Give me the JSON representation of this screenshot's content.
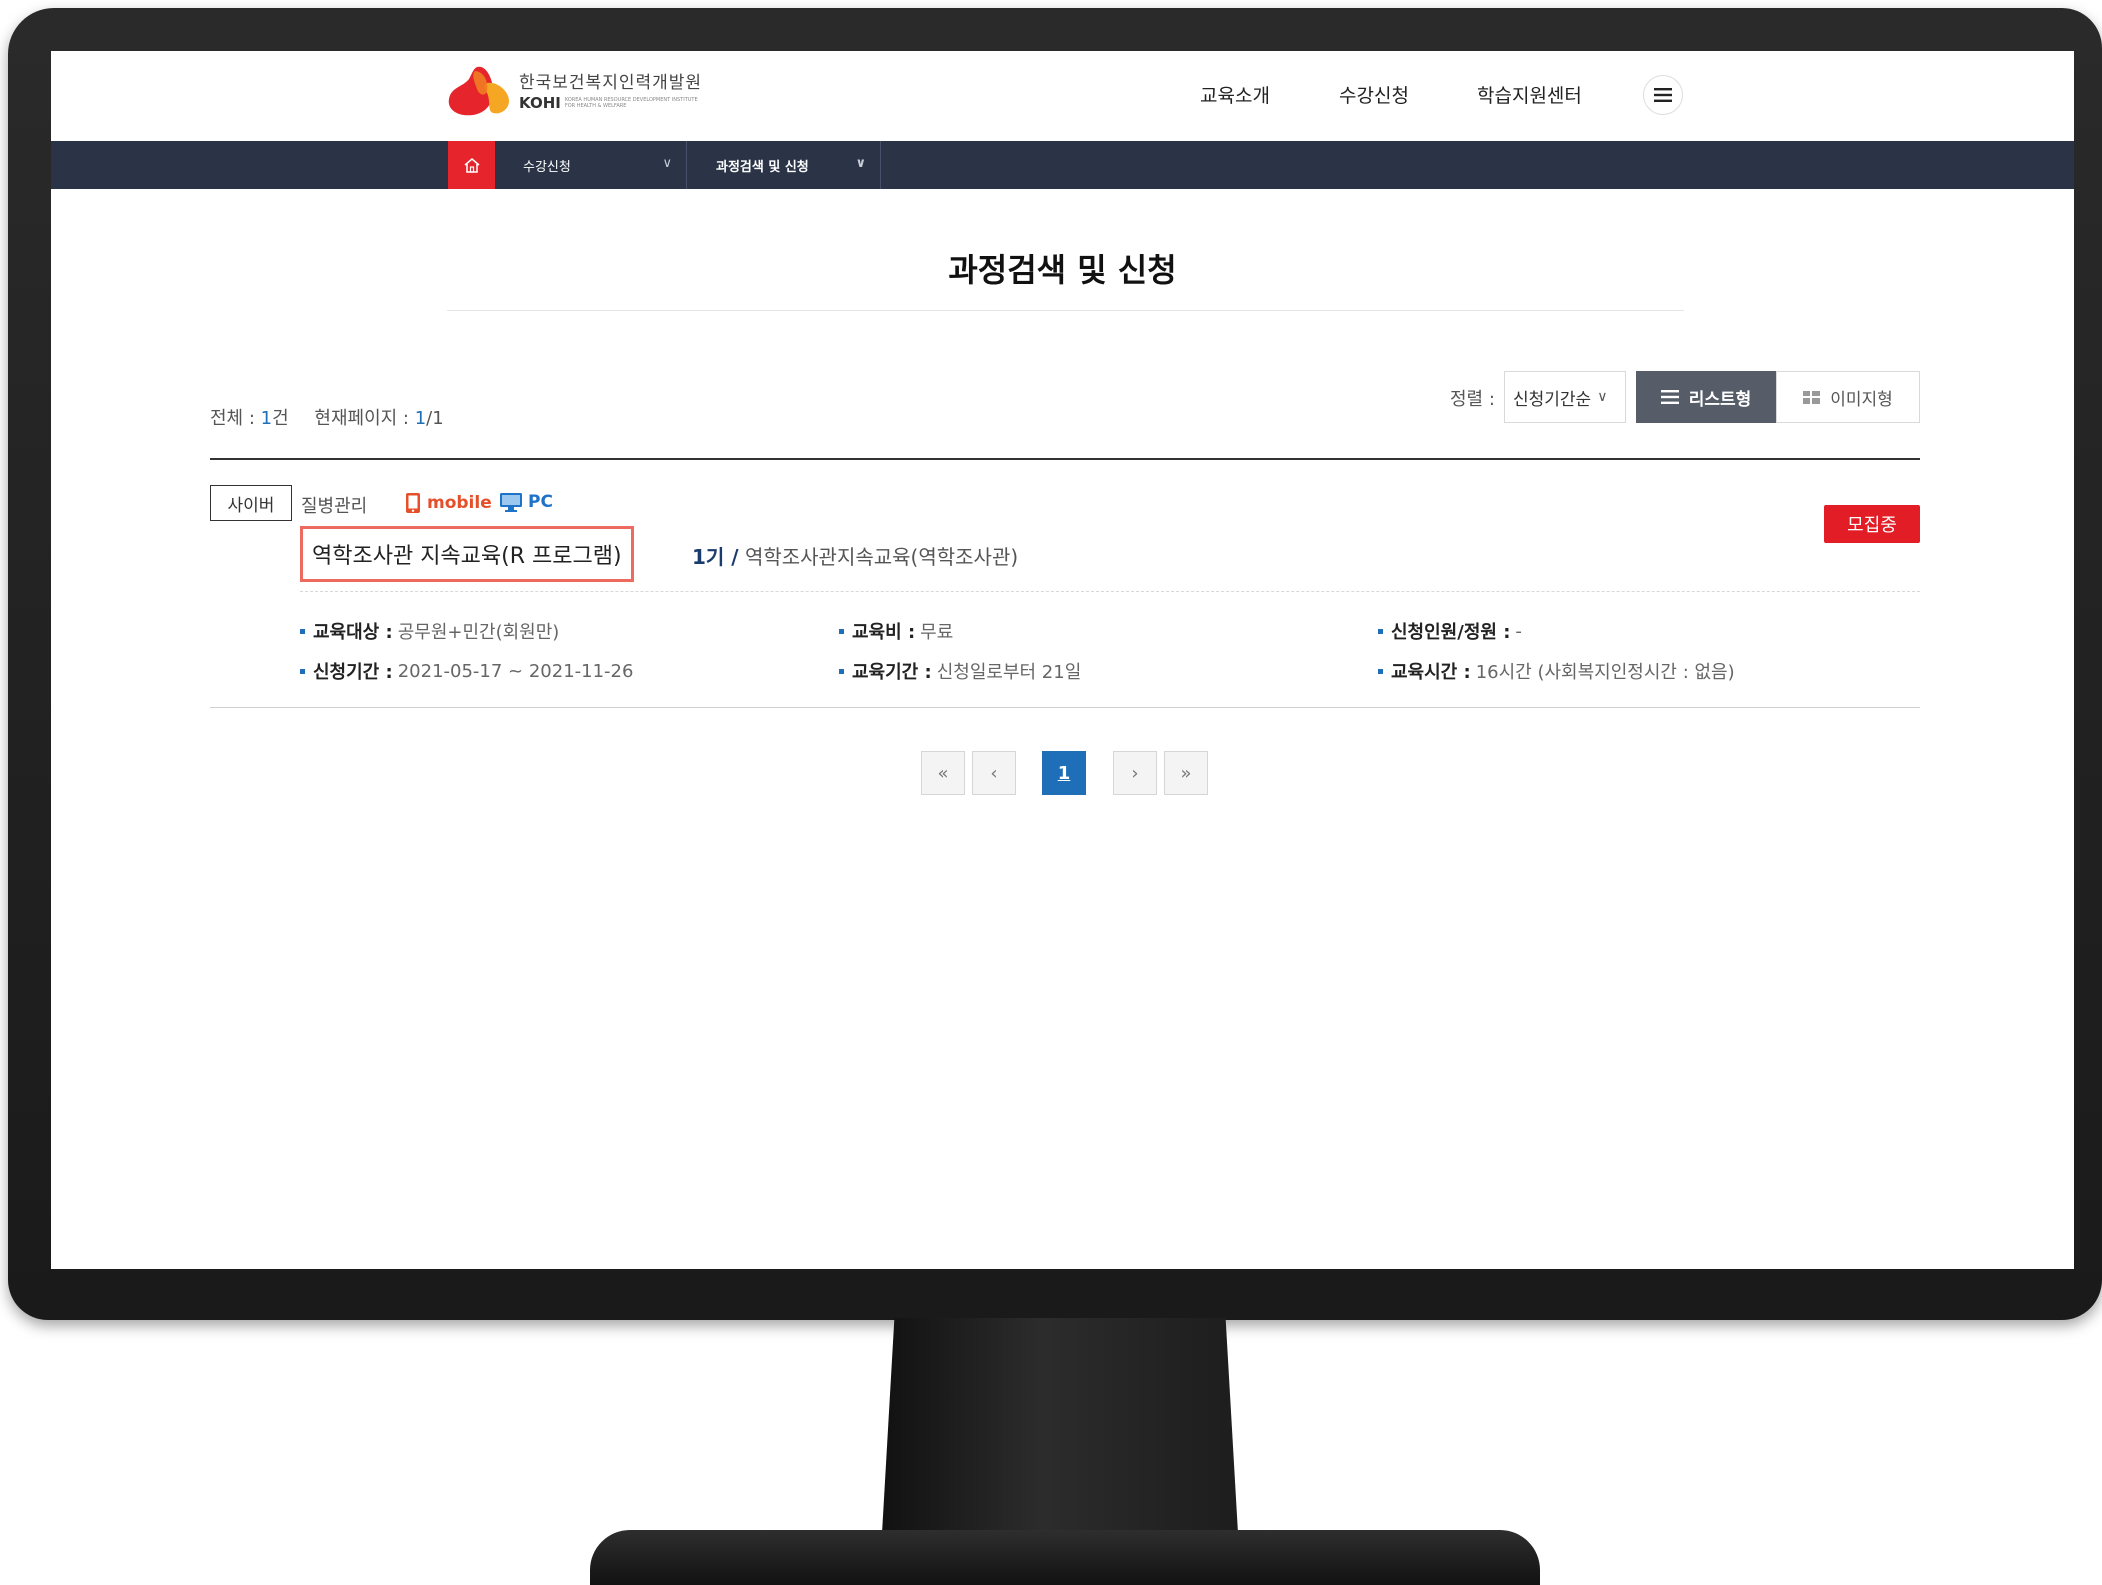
{
  "header": {
    "logo_kr": "한국보건복지인력개발원",
    "logo_en": "KOHI",
    "logo_sub": "KOREA HUMAN RESOURCE DEVELOPMENT INSTITUTE FOR HEALTH & WELFARE",
    "nav": [
      "교육소개",
      "수강신청",
      "학습지원센터"
    ],
    "menu_icon": "hamburger-icon"
  },
  "subnav": {
    "home_icon": "home-icon",
    "level1": "수강신청",
    "level2": "과정검색 및 신청"
  },
  "page": {
    "title": "과정검색 및 신청"
  },
  "summary": {
    "total_label": "전체 : ",
    "total_value": "1",
    "total_unit": "건",
    "page_label": "현재페이지 : ",
    "page_value": "1",
    "page_total": "/1"
  },
  "toolbar": {
    "sort_label": "정렬 :",
    "sort_value": "신청기간순",
    "view_list": "리스트형",
    "view_image": "이미지형"
  },
  "course": {
    "type_tag": "사이버",
    "category": "질병관리",
    "device_mobile": "mobile",
    "device_pc": "PC",
    "status": "모집중",
    "title": "역학조사관 지속교육(R 프로그램)",
    "generation": "1기 /",
    "subtitle": "역학조사관지속교육(역학조사관)",
    "info": [
      {
        "key": "교육대상 :",
        "value": "공무원+민간(회원만)"
      },
      {
        "key": "교육비 :",
        "value": "무료"
      },
      {
        "key": "신청인원/정원 :",
        "value": "-"
      },
      {
        "key": "신청기간 :",
        "value": "2021-05-17 ~ 2021-11-26"
      },
      {
        "key": "교육기간 :",
        "value": "신청일로부터 21일"
      },
      {
        "key": "교육시간 :",
        "value": "16시간 (사회복지인정시간 : 없음)"
      }
    ]
  },
  "pagination": {
    "first": "«",
    "prev": "‹",
    "current": "1",
    "next": "›",
    "last": "»"
  },
  "colors": {
    "accent_red": "#e21d26",
    "nav_bg": "#2b3447",
    "link_blue": "#1f6fb8",
    "highlight_border": "#ec6a5e"
  }
}
